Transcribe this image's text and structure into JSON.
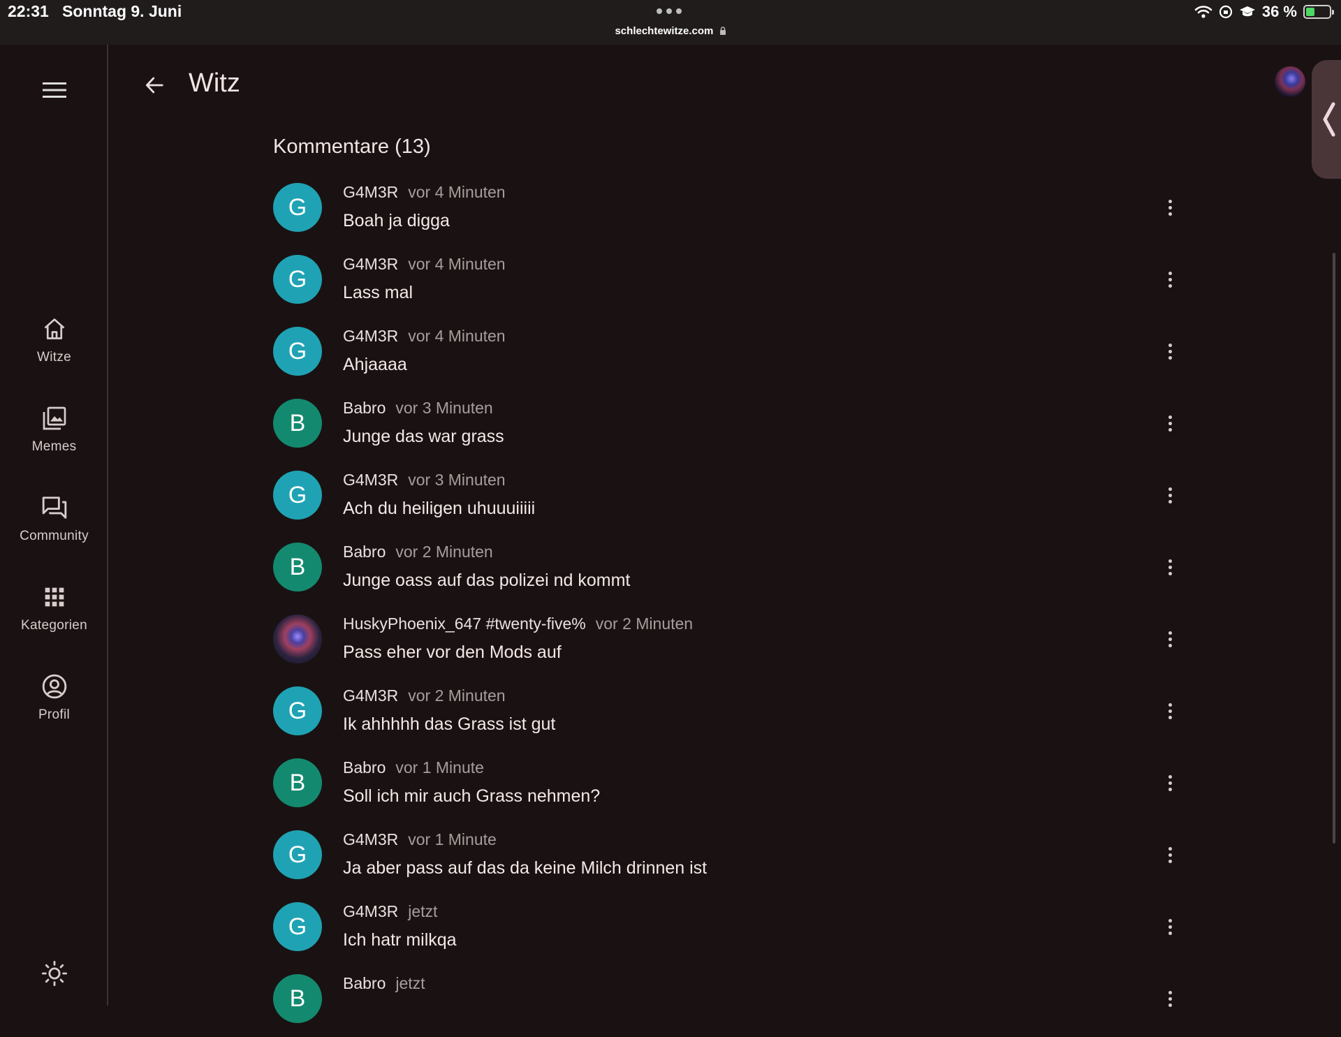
{
  "status_bar": {
    "time": "22:31",
    "date": "Sonntag 9. Juni",
    "url": "schlechtewitze.com",
    "battery": "36 %",
    "battery_level": 0.36
  },
  "sidebar": {
    "menu_icon": "hamburger-menu-icon",
    "items": [
      {
        "label": "Witze",
        "icon": "home-icon"
      },
      {
        "label": "Memes",
        "icon": "image-gallery-icon"
      },
      {
        "label": "Community",
        "icon": "forum-icon"
      },
      {
        "label": "Kategorien",
        "icon": "grid-icon"
      },
      {
        "label": "Profil",
        "icon": "account-circle-icon"
      }
    ],
    "theme_icon": "sun-icon"
  },
  "header": {
    "title": "Witz",
    "back_icon": "arrow-left-icon"
  },
  "comments_section": {
    "title": "Kommentare (13)",
    "comments": [
      {
        "avatar_letter": "G",
        "avatar_color": "#1fa3b4",
        "author": "G4M3R",
        "time": "vor 4 Minuten",
        "text": "Boah ja digga"
      },
      {
        "avatar_letter": "G",
        "avatar_color": "#1fa3b4",
        "author": "G4M3R",
        "time": "vor 4 Minuten",
        "text": "Lass mal"
      },
      {
        "avatar_letter": "G",
        "avatar_color": "#1fa3b4",
        "author": "G4M3R",
        "time": "vor 4 Minuten",
        "text": "Ahjaaaa"
      },
      {
        "avatar_letter": "B",
        "avatar_color": "#138a6f",
        "author": "Babro",
        "time": "vor 3 Minuten",
        "text": "Junge das war grass"
      },
      {
        "avatar_letter": "G",
        "avatar_color": "#1fa3b4",
        "author": "G4M3R",
        "time": "vor 3 Minuten",
        "text": "Ach du heiligen uhuuuiiiii"
      },
      {
        "avatar_letter": "B",
        "avatar_color": "#138a6f",
        "author": "Babro",
        "time": "vor 2 Minuten",
        "text": "Junge oass auf das polizei nd kommt"
      },
      {
        "avatar_letter": "",
        "avatar_color": "image",
        "author": "HuskyPhoenix_647 #twenty-five%",
        "time": "vor 2 Minuten",
        "text": "Pass eher vor den Mods auf"
      },
      {
        "avatar_letter": "G",
        "avatar_color": "#1fa3b4",
        "author": "G4M3R",
        "time": "vor 2 Minuten",
        "text": "Ik ahhhhh das Grass ist gut"
      },
      {
        "avatar_letter": "B",
        "avatar_color": "#138a6f",
        "author": "Babro",
        "time": "vor 1 Minute",
        "text": "Soll ich mir auch Grass nehmen?"
      },
      {
        "avatar_letter": "G",
        "avatar_color": "#1fa3b4",
        "author": "G4M3R",
        "time": "vor 1 Minute",
        "text": "Ja aber pass auf das da keine Milch drinnen ist"
      },
      {
        "avatar_letter": "G",
        "avatar_color": "#1fa3b4",
        "author": "G4M3R",
        "time": "jetzt",
        "text": "Ich hatr milkqa"
      },
      {
        "avatar_letter": "B",
        "avatar_color": "#138a6f",
        "author": "Babro",
        "time": "jetzt",
        "text": ""
      }
    ]
  }
}
